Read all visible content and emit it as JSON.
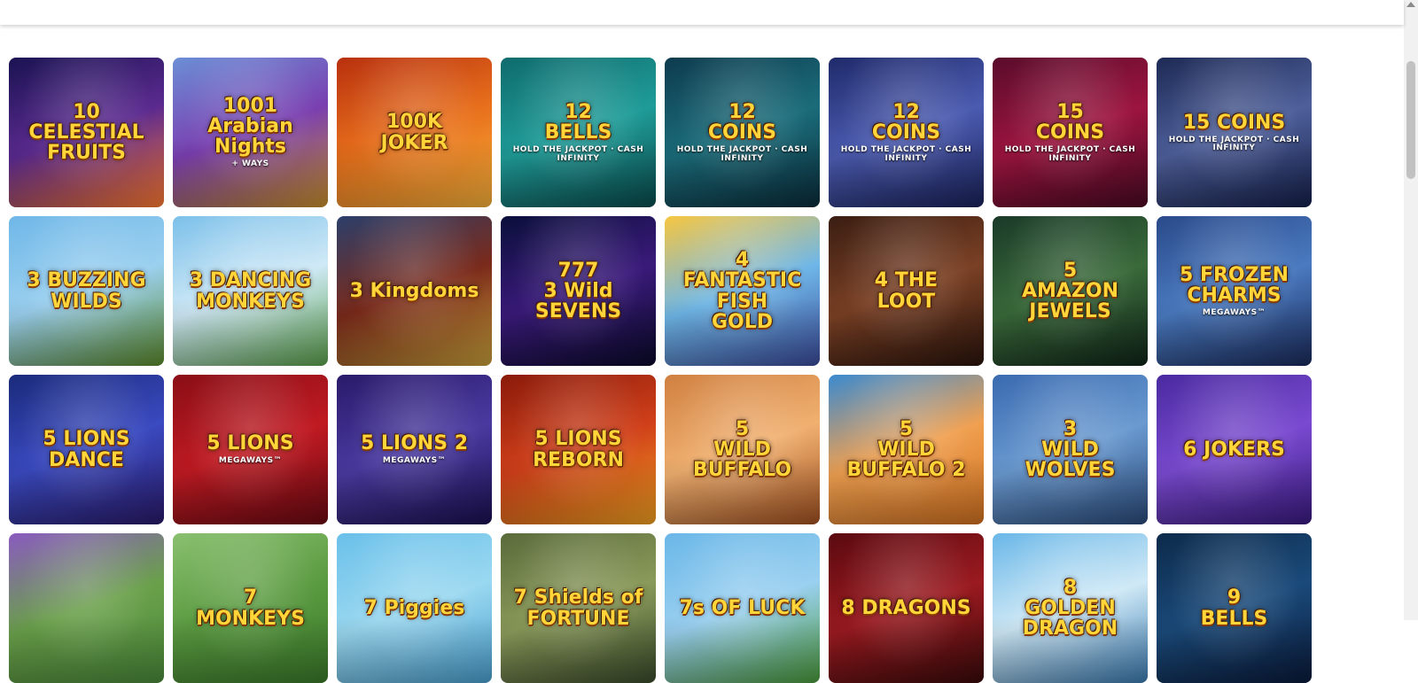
{
  "games": [
    {
      "title": "10\nCELESTIAL\nFRUITS",
      "bg": [
        "#1a1352",
        "#5b2a8f",
        "#ff7a2f"
      ]
    },
    {
      "title": "1001\nArabian\nNights",
      "sub": "+ WAYS",
      "bg": [
        "#6b8fd6",
        "#7a3fb0",
        "#c9902a"
      ]
    },
    {
      "title": "100K\nJOKER",
      "bg": [
        "#b8300e",
        "#e8701c",
        "#f7b13a"
      ]
    },
    {
      "title": "12\nBELLS",
      "sub": "HOLD THE JACKPOT · CASH INFINITY",
      "bg": [
        "#0f6b6d",
        "#1f9c98",
        "#0a4a4c"
      ]
    },
    {
      "title": "12\nCOINS",
      "sub": "HOLD THE JACKPOT · CASH INFINITY",
      "bg": [
        "#0d3b4e",
        "#1b6c7a",
        "#0a2c3a"
      ]
    },
    {
      "title": "12\nCOINS",
      "sub": "HOLD THE JACKPOT · CASH INFINITY",
      "bg": [
        "#1f2a6a",
        "#4b5bb0",
        "#1a225a"
      ]
    },
    {
      "title": "15\nCOINS",
      "sub": "HOLD THE JACKPOT · CASH INFINITY",
      "bg": [
        "#5a0c2a",
        "#9c1440",
        "#4a0a22"
      ]
    },
    {
      "title": "15 COINS",
      "sub": "HOLD THE JACKPOT · CASH INFINITY",
      "bg": [
        "#1d2a55",
        "#4e5f9a",
        "#15204a"
      ]
    },
    {
      "title": "3 BUZZING\nWILDS",
      "bg": [
        "#6fb7e8",
        "#9bd0ef",
        "#5a8a2a"
      ]
    },
    {
      "title": "3 DANCING\nMONKEYS",
      "bg": [
        "#7cc0ea",
        "#cfe9f6",
        "#5aa04a"
      ]
    },
    {
      "title": "3 Kingdoms",
      "bg": [
        "#2b3f6b",
        "#7a2a1a",
        "#c8a03a"
      ]
    },
    {
      "title": "777\n3 Wild\nSEVENS",
      "bg": [
        "#0a0f3a",
        "#3a1a7a",
        "#0a0a2a"
      ]
    },
    {
      "title": "4\nFANTASTIC\nFISH\nGOLD",
      "bg": [
        "#f7c640",
        "#6fb7e8",
        "#3a4a9a"
      ]
    },
    {
      "title": "4 THE\nLOOT",
      "bg": [
        "#3a1d12",
        "#7a4024",
        "#2a140c"
      ]
    },
    {
      "title": "5\nAMAZON\nJEWELS",
      "bg": [
        "#1a3a28",
        "#3a6a3a",
        "#0f2418"
      ]
    },
    {
      "title": "5 FROZEN\nCHARMS",
      "sub": "MEGAWAYS™",
      "bg": [
        "#2a4a8a",
        "#4a7ac0",
        "#1a2a5a"
      ]
    },
    {
      "title": "5 LIONS\nDANCE",
      "bg": [
        "#1a2a7a",
        "#3a4ac0",
        "#2a1a6a"
      ]
    },
    {
      "title": "5 LIONS",
      "sub": "MEGAWAYS™",
      "bg": [
        "#8a0e16",
        "#c01a22",
        "#6a0a12"
      ]
    },
    {
      "title": "5 LIONS 2",
      "sub": "MEGAWAYS™",
      "bg": [
        "#2a1a6a",
        "#4a3aa0",
        "#1a1050"
      ]
    },
    {
      "title": "5 LIONS\nREBORN",
      "bg": [
        "#8a1a0a",
        "#d0401a",
        "#f0a020"
      ]
    },
    {
      "title": "5\nWILD\nBUFFALO",
      "bg": [
        "#d08040",
        "#f0b070",
        "#a05020"
      ]
    },
    {
      "title": "5\nWILD\nBUFFALO 2",
      "bg": [
        "#3a8ad0",
        "#f0a050",
        "#d07020"
      ]
    },
    {
      "title": "3\nWILD\nWOLVES",
      "bg": [
        "#3a6ab0",
        "#6a9ad0",
        "#2a4a7a"
      ]
    },
    {
      "title": "6 JOKERS",
      "bg": [
        "#4a2aa0",
        "#7a4ad0",
        "#3a1a80"
      ]
    },
    {
      "title": "",
      "bg": [
        "#8a5ac0",
        "#6aa04a",
        "#4a8a3a"
      ]
    },
    {
      "title": "7\nMONKEYS",
      "bg": [
        "#8ac070",
        "#5a9a40",
        "#3a7a2a"
      ]
    },
    {
      "title": "7 Piggies",
      "bg": [
        "#6ac0ea",
        "#9ad8f0",
        "#4aa0d0"
      ]
    },
    {
      "title": "7 Shields of\nFORTUNE",
      "bg": [
        "#5a6a3a",
        "#8a9a5a",
        "#3a4a2a"
      ]
    },
    {
      "title": "7s OF LUCK",
      "bg": [
        "#6ab7e8",
        "#9ad0f0",
        "#4a9a3a"
      ]
    },
    {
      "title": "8 DRAGONS",
      "bg": [
        "#5a0a10",
        "#9a1a20",
        "#3a0a0a"
      ]
    },
    {
      "title": "8\nGOLDEN DRAGON",
      "bg": [
        "#6ab7e8",
        "#cfe9f6",
        "#3a7ab0"
      ]
    },
    {
      "title": "9\nBELLS",
      "bg": [
        "#0d2a4a",
        "#1a4a7a",
        "#0a1a3a"
      ]
    }
  ]
}
